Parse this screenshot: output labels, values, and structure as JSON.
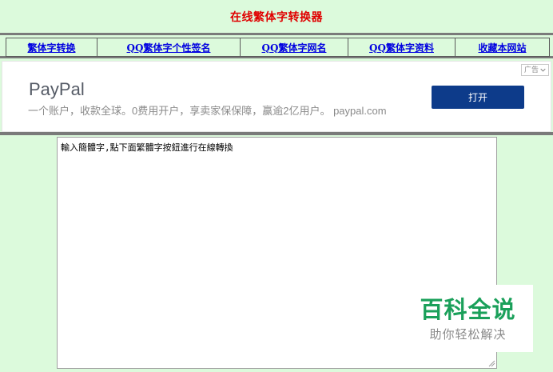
{
  "header": {
    "title": "在线繁体字转换器"
  },
  "nav": {
    "items": [
      {
        "label": "繁体字转换"
      },
      {
        "label": "QQ繁体字个性签名"
      },
      {
        "label": "QQ繁体字网名"
      },
      {
        "label": "QQ繁体字资料"
      },
      {
        "label": "收藏本网站"
      }
    ]
  },
  "ad": {
    "brand": "PayPal",
    "description": "一个账户，收款全球。0费用开户，享卖家保保障，赢逾2亿用户。 paypal.com",
    "button_label": "打开",
    "badge_label": "广告",
    "badge_icon": "chevron-down-icon",
    "button_color": "#0d3b8a"
  },
  "editor": {
    "value": "輸入簡體字,點下面繁體字按鈕進行在線轉換"
  },
  "watermark": {
    "title": "百科全说",
    "subtitle": "助你轻松解决",
    "title_color": "#1aa05a"
  }
}
